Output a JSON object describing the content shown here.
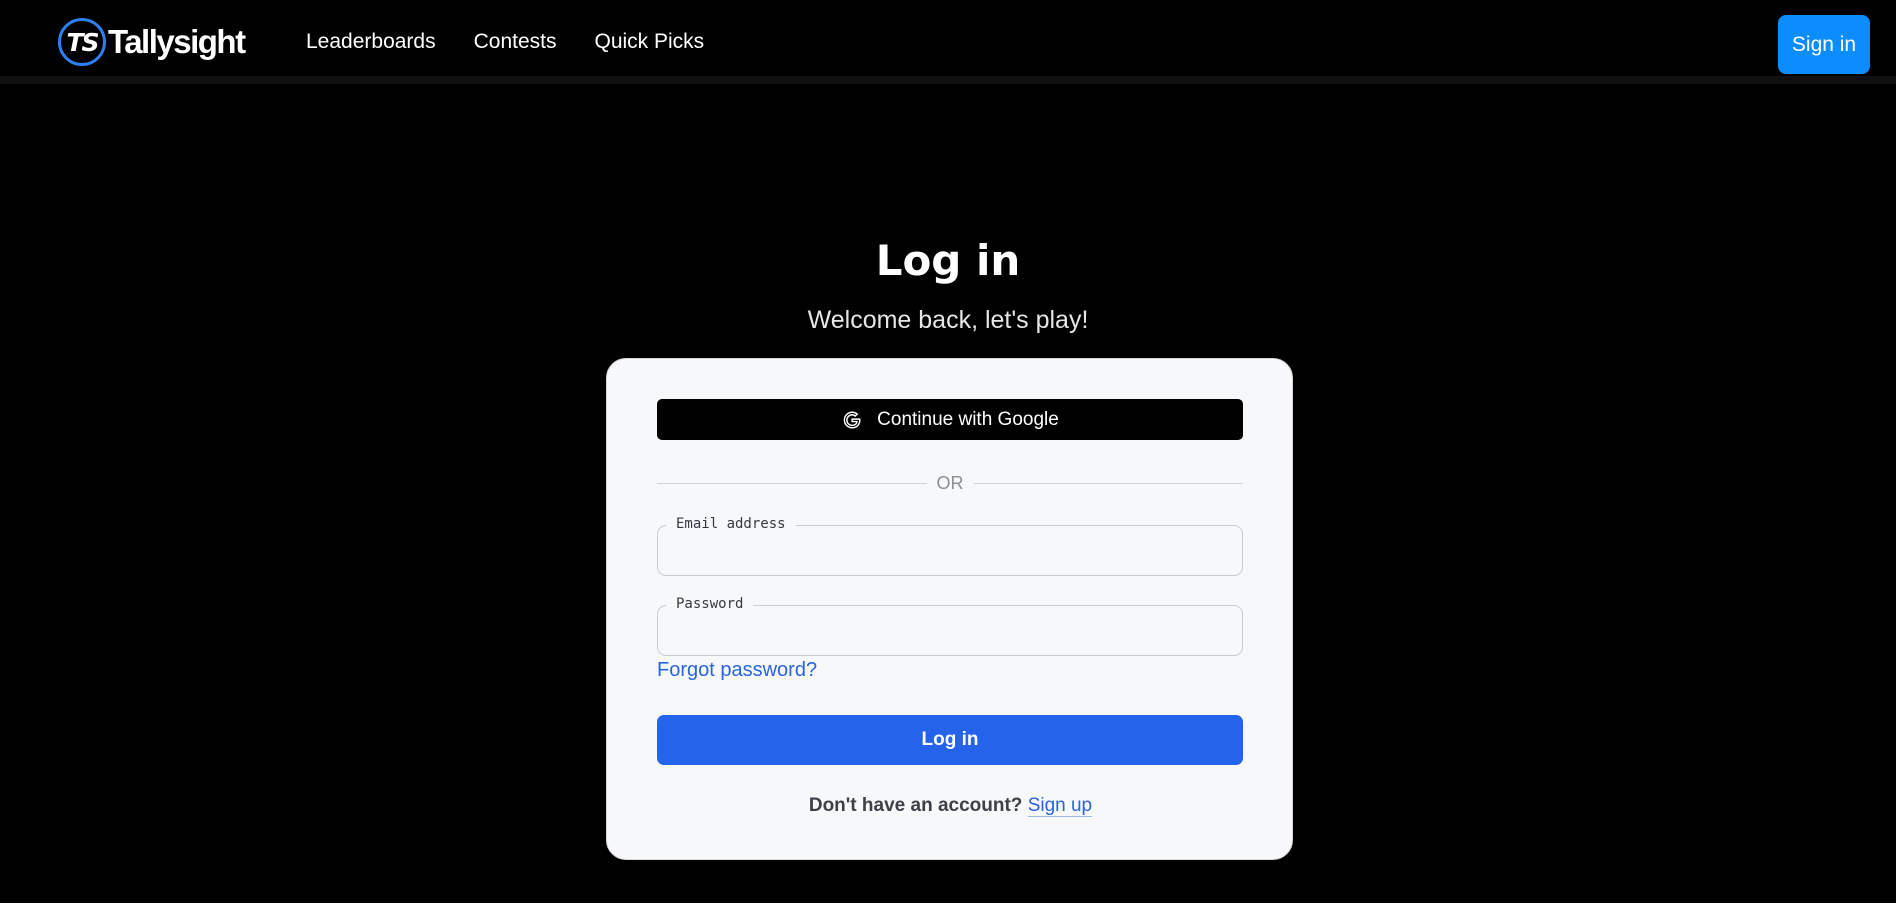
{
  "header": {
    "brand": {
      "mark": "TS",
      "name": "Tallysight"
    },
    "nav": [
      {
        "label": "Leaderboards"
      },
      {
        "label": "Contests"
      },
      {
        "label": "Quick Picks"
      }
    ],
    "signin_label": "Sign in"
  },
  "page": {
    "title": "Log in",
    "subtitle": "Welcome back, let's play!"
  },
  "form": {
    "google_label": "Continue with Google",
    "google_icon": "google-g-icon",
    "divider_text": "OR",
    "email": {
      "label": "Email address",
      "value": "",
      "placeholder": ""
    },
    "password": {
      "label": "Password",
      "value": "",
      "placeholder": ""
    },
    "forgot_label": "Forgot password?",
    "submit_label": "Log in",
    "signup_prompt": "Don't have an account?",
    "signup_label": "Sign up"
  },
  "colors": {
    "background": "#000000",
    "accent_blue": "#0b8cff",
    "primary_button": "#2563eb",
    "link": "#2a64dd",
    "card": "#f7f8fa",
    "logo_ring": "#2b7ff0"
  }
}
